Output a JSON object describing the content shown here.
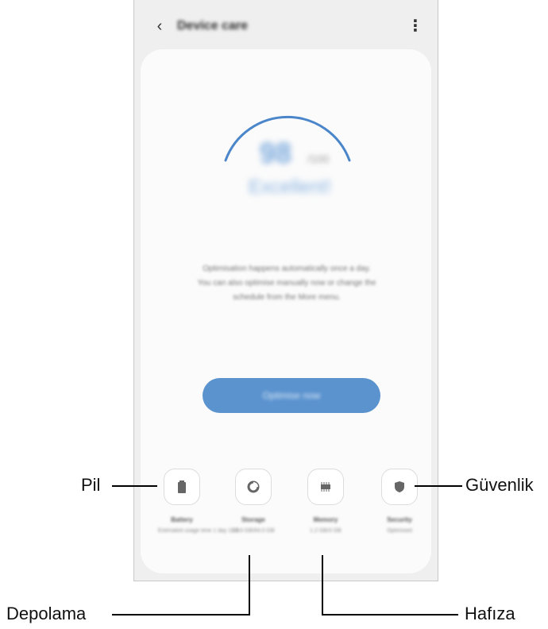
{
  "app": {
    "title": "Device care",
    "back_icon": "back-arrow-icon",
    "more_icon": "more-vertical-icon",
    "accent_color": "#5b93cf"
  },
  "score": {
    "value": "98",
    "unit": "/100",
    "status": "Excellent!"
  },
  "description": [
    "Optimisation happens automatically once a day.",
    "You can also optimise manually now or change the",
    "schedule from the More menu."
  ],
  "optimize_button": "Optimise now",
  "tiles": [
    {
      "name": "Battery",
      "sub": "Estimated usage time 1 day 10 h",
      "icon": "battery-icon"
    },
    {
      "name": "Storage",
      "sub": "18.6 GB/64.0 GB",
      "icon": "storage-pie-icon"
    },
    {
      "name": "Memory",
      "sub": "1.2 GB/3 GB",
      "icon": "memory-chip-icon"
    },
    {
      "name": "Security",
      "sub": "Optimised",
      "icon": "shield-icon"
    }
  ],
  "callouts": {
    "battery": "Pil",
    "storage": "Depolama",
    "memory": "Hafıza",
    "security": "Güvenlik"
  }
}
